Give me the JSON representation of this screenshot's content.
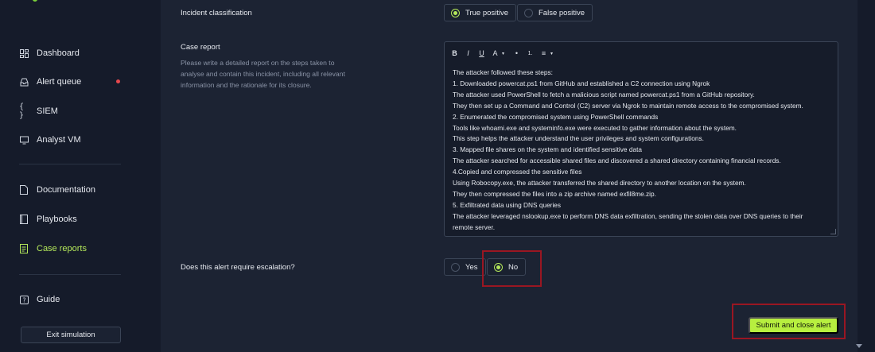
{
  "sidebar": {
    "items": [
      {
        "label": "Dashboard",
        "icon": "dashboard-icon"
      },
      {
        "label": "Alert queue",
        "icon": "inbox-icon"
      },
      {
        "label": "SIEM",
        "icon": "code-braces-icon"
      },
      {
        "label": "Analyst VM",
        "icon": "monitor-icon"
      },
      {
        "label": "Documentation",
        "icon": "document-icon"
      },
      {
        "label": "Playbooks",
        "icon": "book-icon"
      },
      {
        "label": "Case reports",
        "icon": "report-icon"
      },
      {
        "label": "Guide",
        "icon": "help-icon"
      }
    ],
    "active": "Case reports",
    "exit_label": "Exit simulation"
  },
  "form": {
    "classification": {
      "label": "Incident classification",
      "options": [
        "True positive",
        "False positive"
      ],
      "selected": "True positive"
    },
    "case_report": {
      "label": "Case report",
      "description": "Please write a detailed report on the steps taken to analyse and contain this incident, including all relevant information and the rationale for its closure.",
      "toolbar": [
        "B",
        "I",
        "U",
        "A",
        "•",
        "1.",
        "≡"
      ],
      "lines": [
        "The attacker followed these steps:",
        "1. Downloaded powercat.ps1 from GitHub and established a C2 connection using Ngrok",
        "The attacker used PowerShell to fetch a malicious script named powercat.ps1 from a GitHub repository.",
        "They then set up a Command and Control (C2) server via Ngrok to maintain remote access to the compromised system.",
        "2. Enumerated the compromised system using PowerShell commands",
        "Tools like whoami.exe and systeminfo.exe were executed to gather information about the system.",
        "This step helps the attacker understand the user privileges and system configurations.",
        "3. Mapped file shares on the system and identified sensitive data",
        "The attacker searched for accessible shared files and discovered a shared directory containing financial records.",
        "4.Copied and compressed the sensitive files",
        "Using Robocopy.exe, the attacker transferred the shared directory to another location on the system.",
        "They then compressed the files into a zip archive named exfil8me.zip.",
        "5. Exfiltrated data using DNS queries",
        "The attacker leveraged nslookup.exe to perform DNS data exfiltration, sending the stolen data over DNS queries to their",
        "remote server."
      ]
    },
    "escalation": {
      "label": "Does this alert require escalation?",
      "options": [
        "Yes",
        "No"
      ],
      "selected": "No"
    },
    "submit_label": "Submit and close alert"
  },
  "colors": {
    "accent": "#b7ef3f",
    "highlight": "#9a1622",
    "alert_dot": "#e5484d"
  }
}
